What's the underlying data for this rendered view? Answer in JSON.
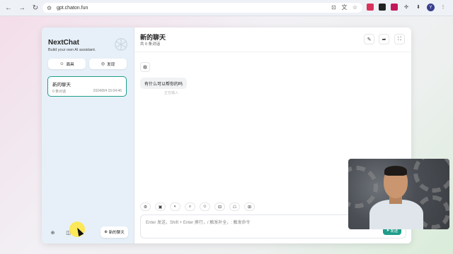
{
  "browser": {
    "url": "gpt.chaton.fun",
    "profile_initial": "Y"
  },
  "sidebar": {
    "brand_title": "NextChat",
    "brand_subtitle": "Build your own AI assistant.",
    "mask_button": "面具",
    "discover_button": "发现",
    "chats": [
      {
        "title": "新的聊天",
        "count": "0 条对话",
        "time": "2024/8/4 15:04:46"
      }
    ],
    "new_chat_button": "新的聊天"
  },
  "main": {
    "title": "新的聊天",
    "subtitle": "共 0 条对话",
    "greeting": "有什么可以帮你的吗",
    "greeting_status": "正在输入",
    "input_placeholder": "Enter 发送，Shift + Enter 换行，/ 触发补全，: 触发命令",
    "send_button": "发送"
  },
  "colors": {
    "accent": "#1f9d8a",
    "sidebar_bg": "#e7f0f8"
  }
}
